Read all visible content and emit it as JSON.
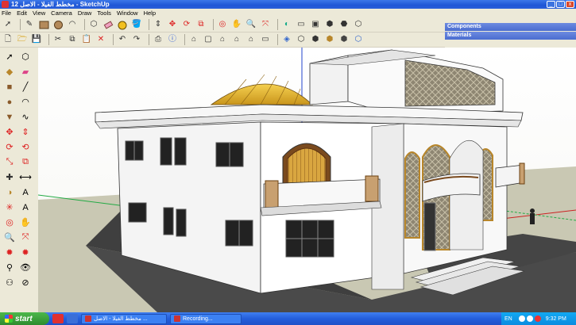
{
  "window": {
    "title": "مخطط الفيلا - الاصل 12 - SketchUp",
    "minimize": "_",
    "maximize": "□",
    "close": "x"
  },
  "menu": {
    "items": [
      "File",
      "Edit",
      "View",
      "Camera",
      "Draw",
      "Tools",
      "Window",
      "Help"
    ]
  },
  "trays": {
    "components": "Components",
    "materials": "Materials"
  },
  "taskbar": {
    "start": "start",
    "tasks": [
      "مخطط الفيلا - الاصل ...",
      "Recording..."
    ],
    "lang": "EN",
    "clock": "9:32 PM"
  },
  "colors": {
    "sky": "#ffffff",
    "ground": "#c9c8b3",
    "accent": "#245edb"
  }
}
